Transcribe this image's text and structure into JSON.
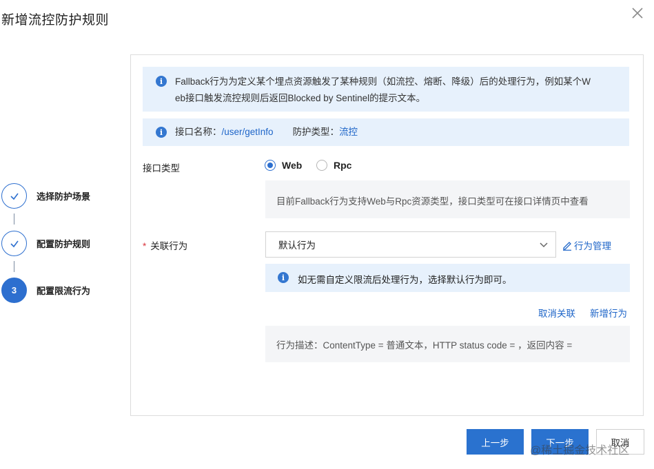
{
  "dialog": {
    "title": "新增流控防护规则"
  },
  "steps": [
    {
      "label": "选择防护场景",
      "state": "done",
      "icon": "check-icon"
    },
    {
      "label": "配置防护规则",
      "state": "done",
      "icon": "check-icon"
    },
    {
      "label": "配置限流行为",
      "state": "active",
      "number": "3"
    }
  ],
  "notices": {
    "fallback_line1": "Fallback行为为定义某个埋点资源触发了某种规则（如流控、熔断、降级）后的处理行为，例如某个W",
    "fallback_line2": "eb接口触发流控规则后返回Blocked by Sentinel的提示文本。",
    "interface_name_label": "接口名称：",
    "interface_name_value": "/user/getInfo",
    "protect_type_label": "防护类型：",
    "protect_type_value": "流控"
  },
  "form": {
    "interface_type_label": "接口类型",
    "radio_options": [
      {
        "label": "Web",
        "selected": true
      },
      {
        "label": "Rpc",
        "selected": false
      }
    ],
    "interface_type_hint": "目前Fallback行为支持Web与Rpc资源类型，接口类型可在接口详情页中查看",
    "required_mark": "*",
    "behavior_label": "关联行为",
    "behavior_select_value": "默认行为",
    "manage_link": "行为管理",
    "behavior_notice": "如无需自定义限流后处理行为，选择默认行为即可。",
    "unlink_link": "取消关联",
    "new_behavior_link": "新增行为",
    "behavior_description": "行为描述：ContentType = 普通文本，HTTP status code = ，返回内容 ="
  },
  "footer": {
    "prev_button": "上一步",
    "next_button": "下一步",
    "cancel_button": "取消"
  },
  "watermark": "@稀土掘金技术社区",
  "colors": {
    "primary": "#2a72cf",
    "link": "#1e65c8",
    "notice_bg": "#e7f1fc",
    "hint_bg": "#f4f5f7",
    "required": "#d9363e"
  }
}
